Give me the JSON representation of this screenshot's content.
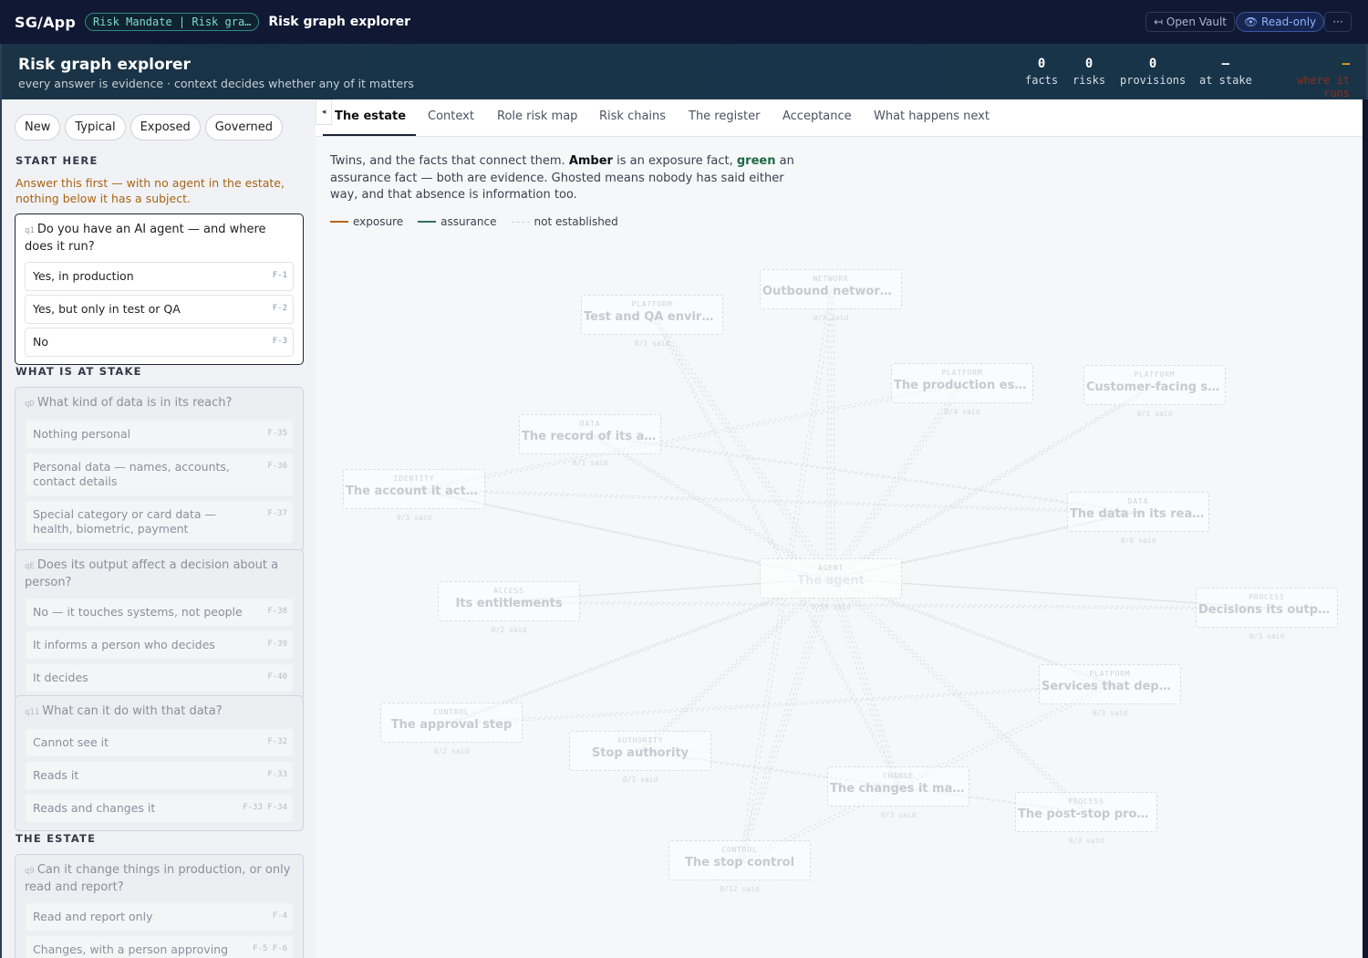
{
  "topbar": {
    "brand": "SG/App",
    "breadcrumb": "Risk Mandate | Risk gra…",
    "title": "Risk graph explorer",
    "open_vault": "↤ Open Vault",
    "read_only": "👁 Read-only",
    "more": "···"
  },
  "header": {
    "title": "Risk graph explorer",
    "subtitle": "every answer is evidence · context decides whether any of it matters",
    "stats": [
      {
        "value": "0",
        "label": "facts"
      },
      {
        "value": "0",
        "label": "risks"
      },
      {
        "value": "0",
        "label": "provisions"
      },
      {
        "value": "—",
        "label": "at stake"
      },
      {
        "value": "—",
        "label": "where it runs"
      }
    ],
    "colors": {
      "where_it_runs": "#d9541e",
      "dash": "#f0a020"
    }
  },
  "presets": [
    "New",
    "Typical",
    "Exposed",
    "Governed"
  ],
  "left": {
    "start_here": "START HERE",
    "note": "Answer this first — with no agent in the estate, nothing below it has a subject.",
    "at_stake": "WHAT IS AT STAKE",
    "estate": "THE ESTATE",
    "q1": {
      "id": "q1",
      "text": "Do you have an AI agent — and where does it run?",
      "options": [
        {
          "label": "Yes, in production",
          "f": "F-1"
        },
        {
          "label": "Yes, but only in test or QA",
          "f": "F-2"
        },
        {
          "label": "No",
          "f": "F-3"
        }
      ]
    },
    "qD": {
      "id": "qD",
      "text": "What kind of data is in its reach?",
      "options": [
        {
          "label": "Nothing personal",
          "f": "F-35"
        },
        {
          "label": "Personal data — names, accounts, contact details",
          "f": "F-36"
        },
        {
          "label": "Special category or card data — health, biometric, payment",
          "f": "F-37"
        }
      ]
    },
    "qE": {
      "id": "qE",
      "text": "Does its output affect a decision about a person?",
      "options": [
        {
          "label": "No — it touches systems, not people",
          "f": "F-38"
        },
        {
          "label": "It informs a person who decides",
          "f": "F-39"
        },
        {
          "label": "It decides",
          "f": "F-40"
        }
      ]
    },
    "q11": {
      "id": "q11",
      "text": "What can it do with that data?",
      "options": [
        {
          "label": "Cannot see it",
          "f": "F-32"
        },
        {
          "label": "Reads it",
          "f": "F-33"
        },
        {
          "label": "Reads and changes it",
          "f": "F-33  F-34"
        }
      ]
    },
    "q9": {
      "id": "q9",
      "text": "Can it change things in production, or only read and report?",
      "options": [
        {
          "label": "Read and report only",
          "f": "F-4"
        },
        {
          "label": "Changes, with a person approving each one",
          "f": "F-5  F-6"
        }
      ]
    }
  },
  "tabs": [
    "The estate",
    "Context",
    "Role risk map",
    "Risk chains",
    "The register",
    "Acceptance",
    "What happens next"
  ],
  "intro": {
    "t1": "Twins, and the facts that connect them. ",
    "amber": "Amber",
    "t2": " is an exposure fact, ",
    "green": "green",
    "t3": " an assurance fact — both are evidence. Ghosted means nobody has said either way, and that absence is information too."
  },
  "legend": {
    "exposure": "exposure",
    "assurance": "assurance",
    "not_established": "not established",
    "colors": {
      "exposure": "#b5651d",
      "assurance": "#2f6f62",
      "not_established": "#c9ccd2"
    }
  },
  "graph_nodes": [
    {
      "key": "NETWORK",
      "title": "Outbound network acc…",
      "said": "0/3 said"
    },
    {
      "key": "PLATFORM",
      "title": "Test and QA environm…",
      "said": "0/1 said"
    },
    {
      "key": "PLATFORM",
      "title": "The production estate",
      "said": "0/4 said"
    },
    {
      "key": "PLATFORM",
      "title": "Customer-facing syst…",
      "said": "0/1 said"
    },
    {
      "key": "DATA",
      "title": "The record of its ac…",
      "said": "0/1 said"
    },
    {
      "key": "IDENTITY",
      "title": "The account it acts …",
      "said": "0/3 said"
    },
    {
      "key": "DATA",
      "title": "The data in its reach",
      "said": "0/6 said"
    },
    {
      "key": "AGENT",
      "title": "The agent",
      "said": "0/59 said"
    },
    {
      "key": "ACCESS",
      "title": "Its entitlements",
      "said": "0/2 said"
    },
    {
      "key": "PROCESS",
      "title": "Decisions its output…",
      "said": "0/3 said"
    },
    {
      "key": "PLATFORM",
      "title": "Services that depend…",
      "said": "0/3 said"
    },
    {
      "key": "CONTROL",
      "title": "The approval step",
      "said": "0/2 said"
    },
    {
      "key": "AUTHORITY",
      "title": "Stop authority",
      "said": "0/3 said"
    },
    {
      "key": "CHANGE",
      "title": "The changes it makes",
      "said": "0/3 said"
    },
    {
      "key": "PROCESS",
      "title": "The post-stop proced…",
      "said": "0/3 said"
    },
    {
      "key": "CONTROL",
      "title": "The stop control",
      "said": "0/12 said"
    }
  ]
}
